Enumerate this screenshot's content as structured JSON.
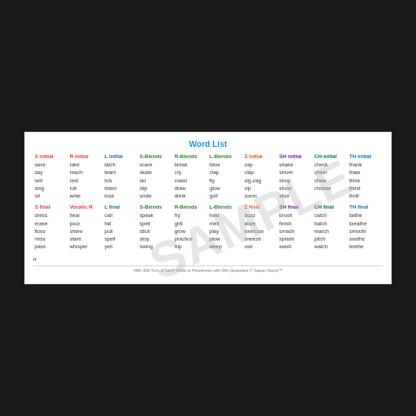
{
  "card": {
    "title": "Word List",
    "watermark": "SAMPLE",
    "footer": "#BK-302 Turn & Talk® Verbs in Phonemes with WH Questions  ©  Sapan Depot™",
    "page": "iv"
  },
  "columns": [
    {
      "id": "s-initial",
      "header": "S initial",
      "headerColor": "red",
      "words1": [
        "save",
        "say",
        "sell",
        "sing",
        "sit"
      ],
      "header2": "S final",
      "headerColor2": "red",
      "words2": [
        "dress",
        "erase",
        "floss",
        "miss",
        "pass"
      ]
    },
    {
      "id": "r-initial",
      "header": "R initial",
      "headerColor": "red",
      "words1": [
        "rake",
        "reach",
        "rest",
        "roll",
        "write"
      ],
      "header2": "Vocalic R",
      "headerColor2": "red",
      "words2": [
        "hear",
        "pour",
        "share",
        "stare",
        "whisper"
      ]
    },
    {
      "id": "l-initial",
      "header": "L initial",
      "headerColor": "blue",
      "words1": [
        "latch",
        "learn",
        "lick",
        "listen",
        "lose"
      ],
      "header2": "L final",
      "headerColor2": "blue",
      "words2": [
        "call",
        "fall",
        "pull",
        "spell",
        "yell"
      ]
    },
    {
      "id": "s-blends",
      "header": "S-Blends",
      "headerColor": "green",
      "words1": [
        "scare",
        "skate",
        "ski",
        "slip",
        "smile"
      ],
      "header2": "S-Blends",
      "headerColor2": "green",
      "words2": [
        "speak",
        "spell",
        "stick",
        "stop",
        "swing"
      ]
    },
    {
      "id": "r-blends",
      "header": "R-Blends",
      "headerColor": "green",
      "words1": [
        "break",
        "cry",
        "crawl",
        "draw",
        "drink"
      ],
      "header2": "R-Blends",
      "headerColor2": "green",
      "words2": [
        "fry",
        "grill",
        "grow",
        "practice",
        "trip"
      ]
    },
    {
      "id": "l-blends",
      "header": "L-Blends",
      "headerColor": "green",
      "words1": [
        "blow",
        "clap",
        "fly",
        "glow",
        "golf"
      ],
      "header2": "L-Blends",
      "headerColor2": "green",
      "words2": [
        "hold",
        "melt",
        "play",
        "plow",
        "sleep"
      ]
    },
    {
      "id": "z-initial",
      "header": "Z initial",
      "headerColor": "orange",
      "words1": [
        "zap",
        "clap",
        "zig-zag",
        "zip",
        "zoom"
      ],
      "header2": "Z final",
      "headerColor2": "orange",
      "words2": [
        "buzz",
        "doze",
        "exercise",
        "sneeze",
        "use"
      ]
    },
    {
      "id": "sh-initial",
      "header": "SH initial",
      "headerColor": "purple",
      "words1": [
        "shake",
        "shiver",
        "shop",
        "show",
        "shut"
      ],
      "header2": "SH final",
      "headerColor2": "purple",
      "words2": [
        "brush",
        "finish",
        "smash",
        "splash",
        "wash"
      ]
    },
    {
      "id": "ch-initial",
      "header": "CH initial",
      "headerColor": "teal",
      "words1": [
        "check",
        "cheer",
        "chew",
        "choose",
        ""
      ],
      "header2": "CH final",
      "headerColor2": "teal",
      "words2": [
        "catch",
        "hatch",
        "march",
        "pitch",
        "watch"
      ]
    },
    {
      "id": "th-initial",
      "header": "TH initial",
      "headerColor": "blue",
      "words1": [
        "thank",
        "thaw",
        "think",
        "thirst",
        "thrill"
      ],
      "header2": "TH final",
      "headerColor2": "blue",
      "words2": [
        "bathe",
        "breathe",
        "smooth",
        "soothe",
        "teethe"
      ]
    }
  ]
}
